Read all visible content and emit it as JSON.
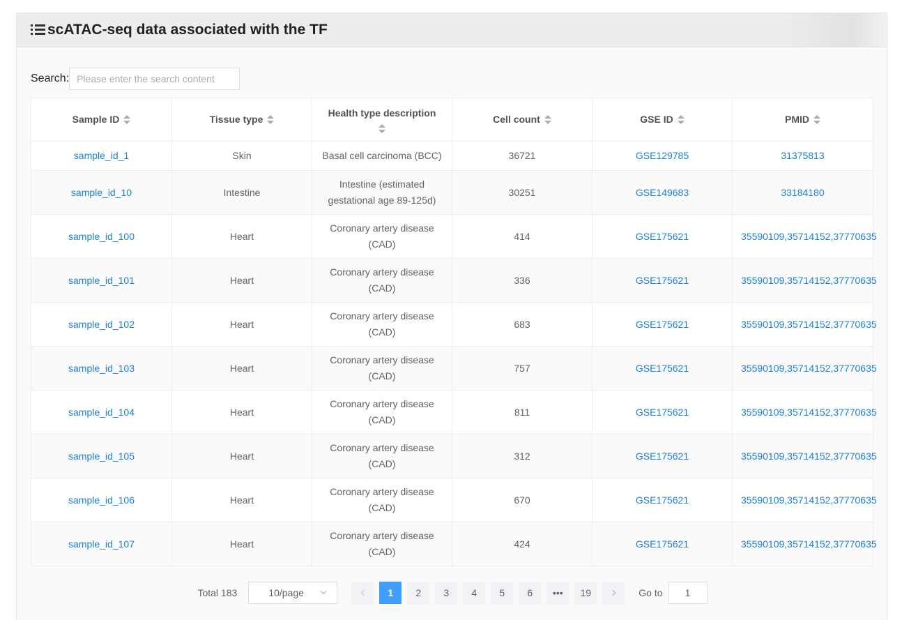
{
  "panel": {
    "title": "scATAC-seq data associated with the TF"
  },
  "search": {
    "label": "Search:",
    "placeholder": "Please enter the search content",
    "value": ""
  },
  "table": {
    "columns": [
      "Sample ID",
      "Tissue type",
      "Health type description",
      "Cell count",
      "GSE ID",
      "PMID"
    ],
    "rows": [
      [
        "sample_id_1",
        "Skin",
        "Basal cell carcinoma (BCC)",
        "36721",
        "GSE129785",
        "31375813"
      ],
      [
        "sample_id_10",
        "Intestine",
        "Intestine (estimated gestational age 89-125d)",
        "30251",
        "GSE149683",
        "33184180"
      ],
      [
        "sample_id_100",
        "Heart",
        "Coronary artery disease (CAD)",
        "414",
        "GSE175621",
        "35590109,35714152,37770635"
      ],
      [
        "sample_id_101",
        "Heart",
        "Coronary artery disease (CAD)",
        "336",
        "GSE175621",
        "35590109,35714152,37770635"
      ],
      [
        "sample_id_102",
        "Heart",
        "Coronary artery disease (CAD)",
        "683",
        "GSE175621",
        "35590109,35714152,37770635"
      ],
      [
        "sample_id_103",
        "Heart",
        "Coronary artery disease (CAD)",
        "757",
        "GSE175621",
        "35590109,35714152,37770635"
      ],
      [
        "sample_id_104",
        "Heart",
        "Coronary artery disease (CAD)",
        "811",
        "GSE175621",
        "35590109,35714152,37770635"
      ],
      [
        "sample_id_105",
        "Heart",
        "Coronary artery disease (CAD)",
        "312",
        "GSE175621",
        "35590109,35714152,37770635"
      ],
      [
        "sample_id_106",
        "Heart",
        "Coronary artery disease (CAD)",
        "670",
        "GSE175621",
        "35590109,35714152,37770635"
      ],
      [
        "sample_id_107",
        "Heart",
        "Coronary artery disease (CAD)",
        "424",
        "GSE175621",
        "35590109,35714152,37770635"
      ]
    ]
  },
  "pagination": {
    "total": "Total 183",
    "page_size": "10/page",
    "pages": [
      "1",
      "2",
      "3",
      "4",
      "5",
      "6",
      "•••",
      "19"
    ],
    "active_page": "1",
    "goto_label": "Go to",
    "goto_value": "1"
  }
}
